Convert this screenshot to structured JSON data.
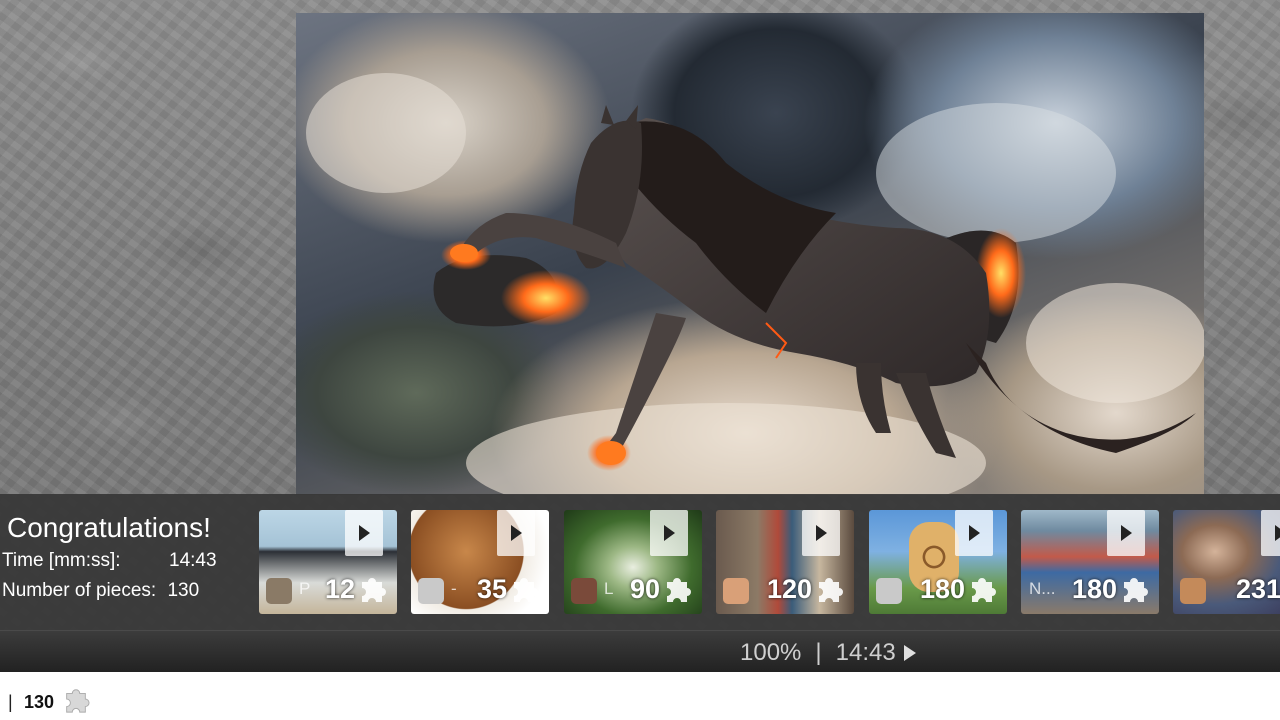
{
  "result": {
    "title": "Congratulations!",
    "time_label": "Time [mm:ss]:",
    "time_value": "14:43",
    "pieces_label": "Number of pieces:",
    "pieces_value": "130"
  },
  "thumbnails": [
    {
      "author": "P",
      "pieces": "12",
      "theme": "penguins"
    },
    {
      "author": "-",
      "pieces": "35",
      "theme": "beagle puppy"
    },
    {
      "author": "L",
      "pieces": "90",
      "theme": "garden archway"
    },
    {
      "author": "",
      "pieces": "120",
      "theme": "totem poles"
    },
    {
      "author": "",
      "pieces": "180",
      "theme": "giraffe"
    },
    {
      "author": "N...",
      "pieces": "180",
      "theme": "market"
    },
    {
      "author": "",
      "pieces": "231",
      "theme": "man portrait"
    }
  ],
  "status": {
    "zoom": "100%",
    "separator": "|",
    "time": "14:43"
  },
  "footer": {
    "separator": "|",
    "pieces": "130"
  },
  "colors": {
    "panel": "#373737",
    "workspace": "#808080",
    "lava": "#ff5a14"
  }
}
